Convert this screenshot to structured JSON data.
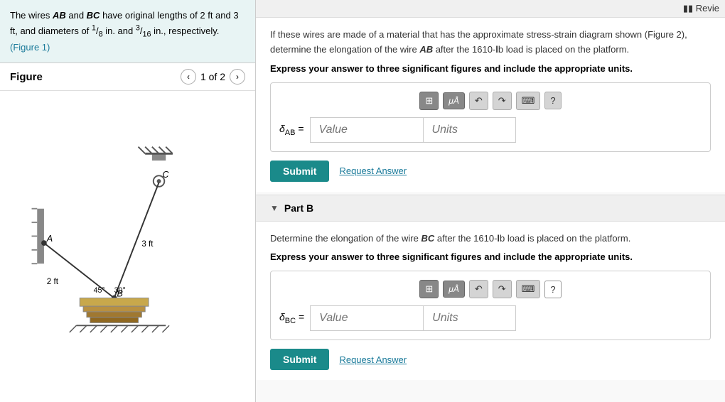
{
  "left": {
    "problem_text_line1": "The wires AB and BC have original lengths of 2",
    "problem_text_line2": "ft and 3 ft, and diameters of",
    "fraction1_num": "1",
    "fraction1_den": "8",
    "fraction2_num": "3",
    "fraction2_den": "16",
    "problem_text_line3": "in. and",
    "problem_text_line4": "in.,",
    "problem_text_line5": "respectively.",
    "figure_ref": "(Figure 1)",
    "figure_title": "Figure",
    "page_indicator": "1 of 2"
  },
  "top_bar": {
    "review_label": "Revie"
  },
  "part_a": {
    "description": "If these wires are made of a material that has the approximate stress-strain diagram shown (Figure 2), determine the elongation of the wire AB after the 1610-lb load is placed on the platform.",
    "ab_label": "AB",
    "lb_text": "1610-lb",
    "instruction": "Express your answer to three significant figures and include the appropriate units.",
    "delta_label": "δ",
    "delta_sub": "AB",
    "equals": "=",
    "value_placeholder": "Value",
    "units_placeholder": "Units",
    "submit_label": "Submit",
    "request_answer_label": "Request Answer"
  },
  "part_b": {
    "header": "Part B",
    "description": "Determine the elongation of the wire BC after the 1610-lb load is placed on the platform.",
    "bc_label": "BC",
    "lb_text": "1610-lb",
    "instruction": "Express your answer to three significant figures and include the appropriate units.",
    "delta_label": "δ",
    "delta_sub": "BC",
    "equals": "=",
    "value_placeholder": "Value",
    "units_placeholder": "Units",
    "submit_label": "Submit",
    "request_answer_label": "Request Answer"
  },
  "toolbar": {
    "grid_icon": "⊞",
    "ua_label": "μÅ",
    "undo_icon": "↺",
    "redo_icon": "↻",
    "keyboard_icon": "⌨",
    "help_icon": "?"
  },
  "figure": {
    "angle1": "45°",
    "angle2": "30°",
    "length_bc": "3 ft",
    "length_ab": "2 ft",
    "label_a": "A",
    "label_b": "B",
    "label_c": "C"
  }
}
